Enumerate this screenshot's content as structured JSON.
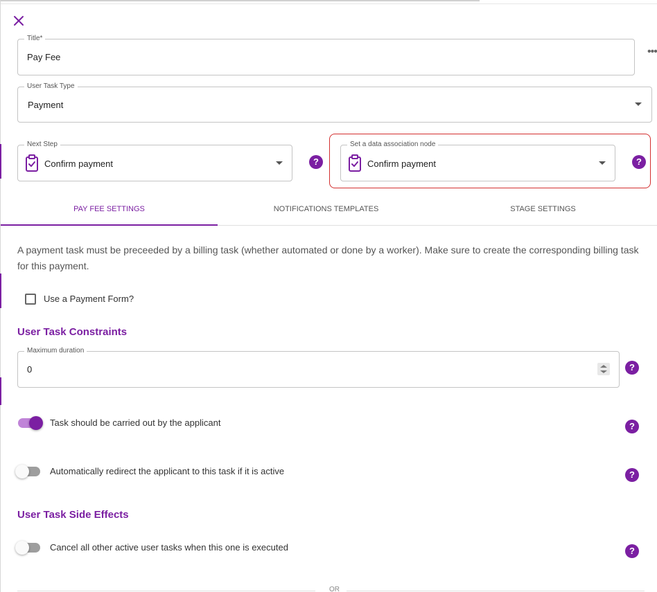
{
  "form": {
    "title_label": "Title*",
    "title_value": "Pay Fee",
    "task_type_label": "User Task Type",
    "task_type_value": "Payment",
    "next_step_label": "Next Step",
    "next_step_value": "Confirm payment",
    "data_node_label": "Set a data association node",
    "data_node_value": "Confirm payment"
  },
  "tabs": [
    {
      "label": "PAY FEE SETTINGS",
      "active": true
    },
    {
      "label": "NOTIFICATIONS TEMPLATES",
      "active": false
    },
    {
      "label": "STAGE SETTINGS",
      "active": false
    }
  ],
  "settings": {
    "description": "A payment task must be preceeded by a billing task (whether automated or done by a worker). Make sure to create the corresponding billing task for this payment.",
    "payment_form_label": "Use a Payment Form?",
    "payment_form_checked": false,
    "constraints_title": "User Task Constraints",
    "max_duration_label": "Maximum duration",
    "max_duration_value": "0",
    "carried_by_applicant_label": "Task should be carried out by the applicant",
    "carried_by_applicant_on": true,
    "auto_redirect_label": "Automatically redirect the applicant to this task if it is active",
    "auto_redirect_on": false,
    "side_effects_title": "User Task Side Effects",
    "cancel_others_label": "Cancel all other active user tasks when this one is executed",
    "cancel_others_on": false,
    "or_label": "OR"
  },
  "icons": {
    "close": "close-icon",
    "help": "help-icon",
    "clipboard": "clipboard-check-icon",
    "more": "more-horizontal-icon"
  },
  "help_glyph": "?",
  "more_glyph": "•••",
  "colors": {
    "accent": "#7b1fa2",
    "highlight_border": "#d32f2f"
  }
}
